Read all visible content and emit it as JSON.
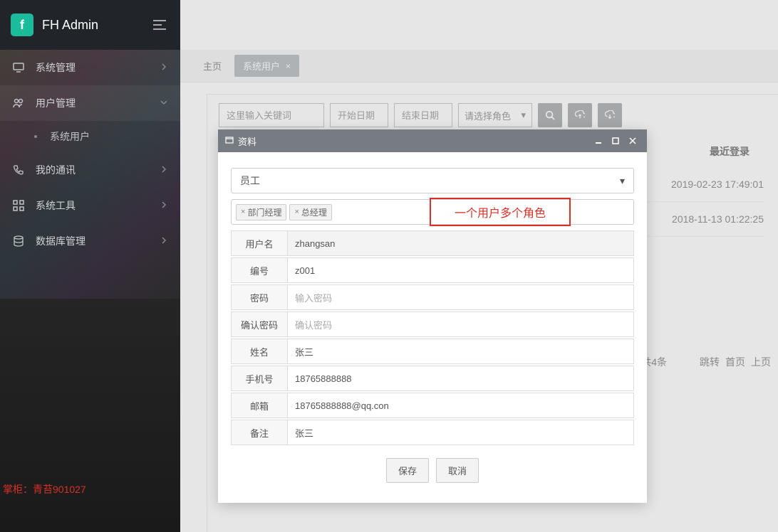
{
  "brand": "FH Admin",
  "sidebar": {
    "items": [
      {
        "label": "系统管理"
      },
      {
        "label": "用户管理"
      },
      {
        "label": "我的通讯"
      },
      {
        "label": "系统工具"
      },
      {
        "label": "数据库管理"
      }
    ],
    "sub": {
      "label": "系统用户"
    },
    "footer": "掌柜：青苔901027"
  },
  "tabs": {
    "home": "主页",
    "active": "系统用户"
  },
  "filters": {
    "keyword_placeholder": "这里输入关键词",
    "start_placeholder": "开始日期",
    "end_placeholder": "结束日期",
    "role_placeholder": "请选择角色"
  },
  "table": {
    "header_recent": "最近登录",
    "rows": [
      {
        "recent": "2019-02-23 17:49:01"
      },
      {
        "recent": "2018-11-13 01:22:25"
      }
    ]
  },
  "pagination": {
    "total": "共4条",
    "jump": "跳转",
    "first": "首页",
    "prev": "上页"
  },
  "dialog": {
    "title": "资料",
    "select_value": "员工",
    "tags": [
      {
        "label": "部门经理"
      },
      {
        "label": "总经理"
      }
    ],
    "annotation": "一个用户多个角色",
    "fields": {
      "username_label": "用户名",
      "username_value": "zhangsan",
      "number_label": "编号",
      "number_value": "z001",
      "password_label": "密码",
      "password_placeholder": "输入密码",
      "confirm_label": "确认密码",
      "confirm_placeholder": "确认密码",
      "name_label": "姓名",
      "name_value": "张三",
      "phone_label": "手机号",
      "phone_value": "18765888888",
      "email_label": "邮箱",
      "email_value": "18765888888@qq.con",
      "remark_label": "备注",
      "remark_value": "张三"
    },
    "buttons": {
      "save": "保存",
      "cancel": "取消"
    }
  }
}
